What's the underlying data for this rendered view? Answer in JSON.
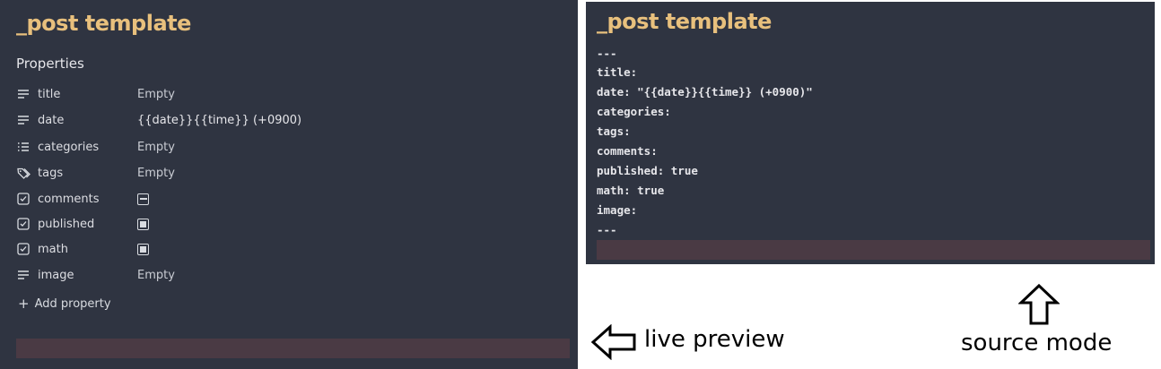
{
  "live": {
    "title": "_post template",
    "properties_heading": "Properties",
    "properties": [
      {
        "icon": "text-lines-icon",
        "key": "title",
        "value": "Empty",
        "type": "text"
      },
      {
        "icon": "text-lines-icon",
        "key": "date",
        "value": "{{date}}{{time}} (+0900)",
        "type": "text"
      },
      {
        "icon": "list-icon",
        "key": "categories",
        "value": "Empty",
        "type": "text"
      },
      {
        "icon": "tags-icon",
        "key": "tags",
        "value": "Empty",
        "type": "text"
      },
      {
        "icon": "checkbox-icon",
        "key": "comments",
        "value": "indeterminate",
        "type": "checkbox"
      },
      {
        "icon": "checkbox-icon",
        "key": "published",
        "value": "checked",
        "type": "checkbox"
      },
      {
        "icon": "checkbox-icon",
        "key": "math",
        "value": "checked",
        "type": "checkbox"
      },
      {
        "icon": "text-lines-icon",
        "key": "image",
        "value": "Empty",
        "type": "text"
      }
    ],
    "add_property": "Add property"
  },
  "source": {
    "title": "_post template",
    "lines": [
      "---",
      "title:",
      "date: \"{{date}}{{time}} (+0900)\"",
      "categories:",
      "tags:",
      "comments:",
      "published: true",
      "math: true",
      "image:",
      "---"
    ]
  },
  "captions": {
    "live_preview": "live preview",
    "source_mode": "source mode"
  },
  "colors": {
    "pane_bg": "#2f3441",
    "title": "#e8c07d",
    "bar": "#4a3a44"
  }
}
